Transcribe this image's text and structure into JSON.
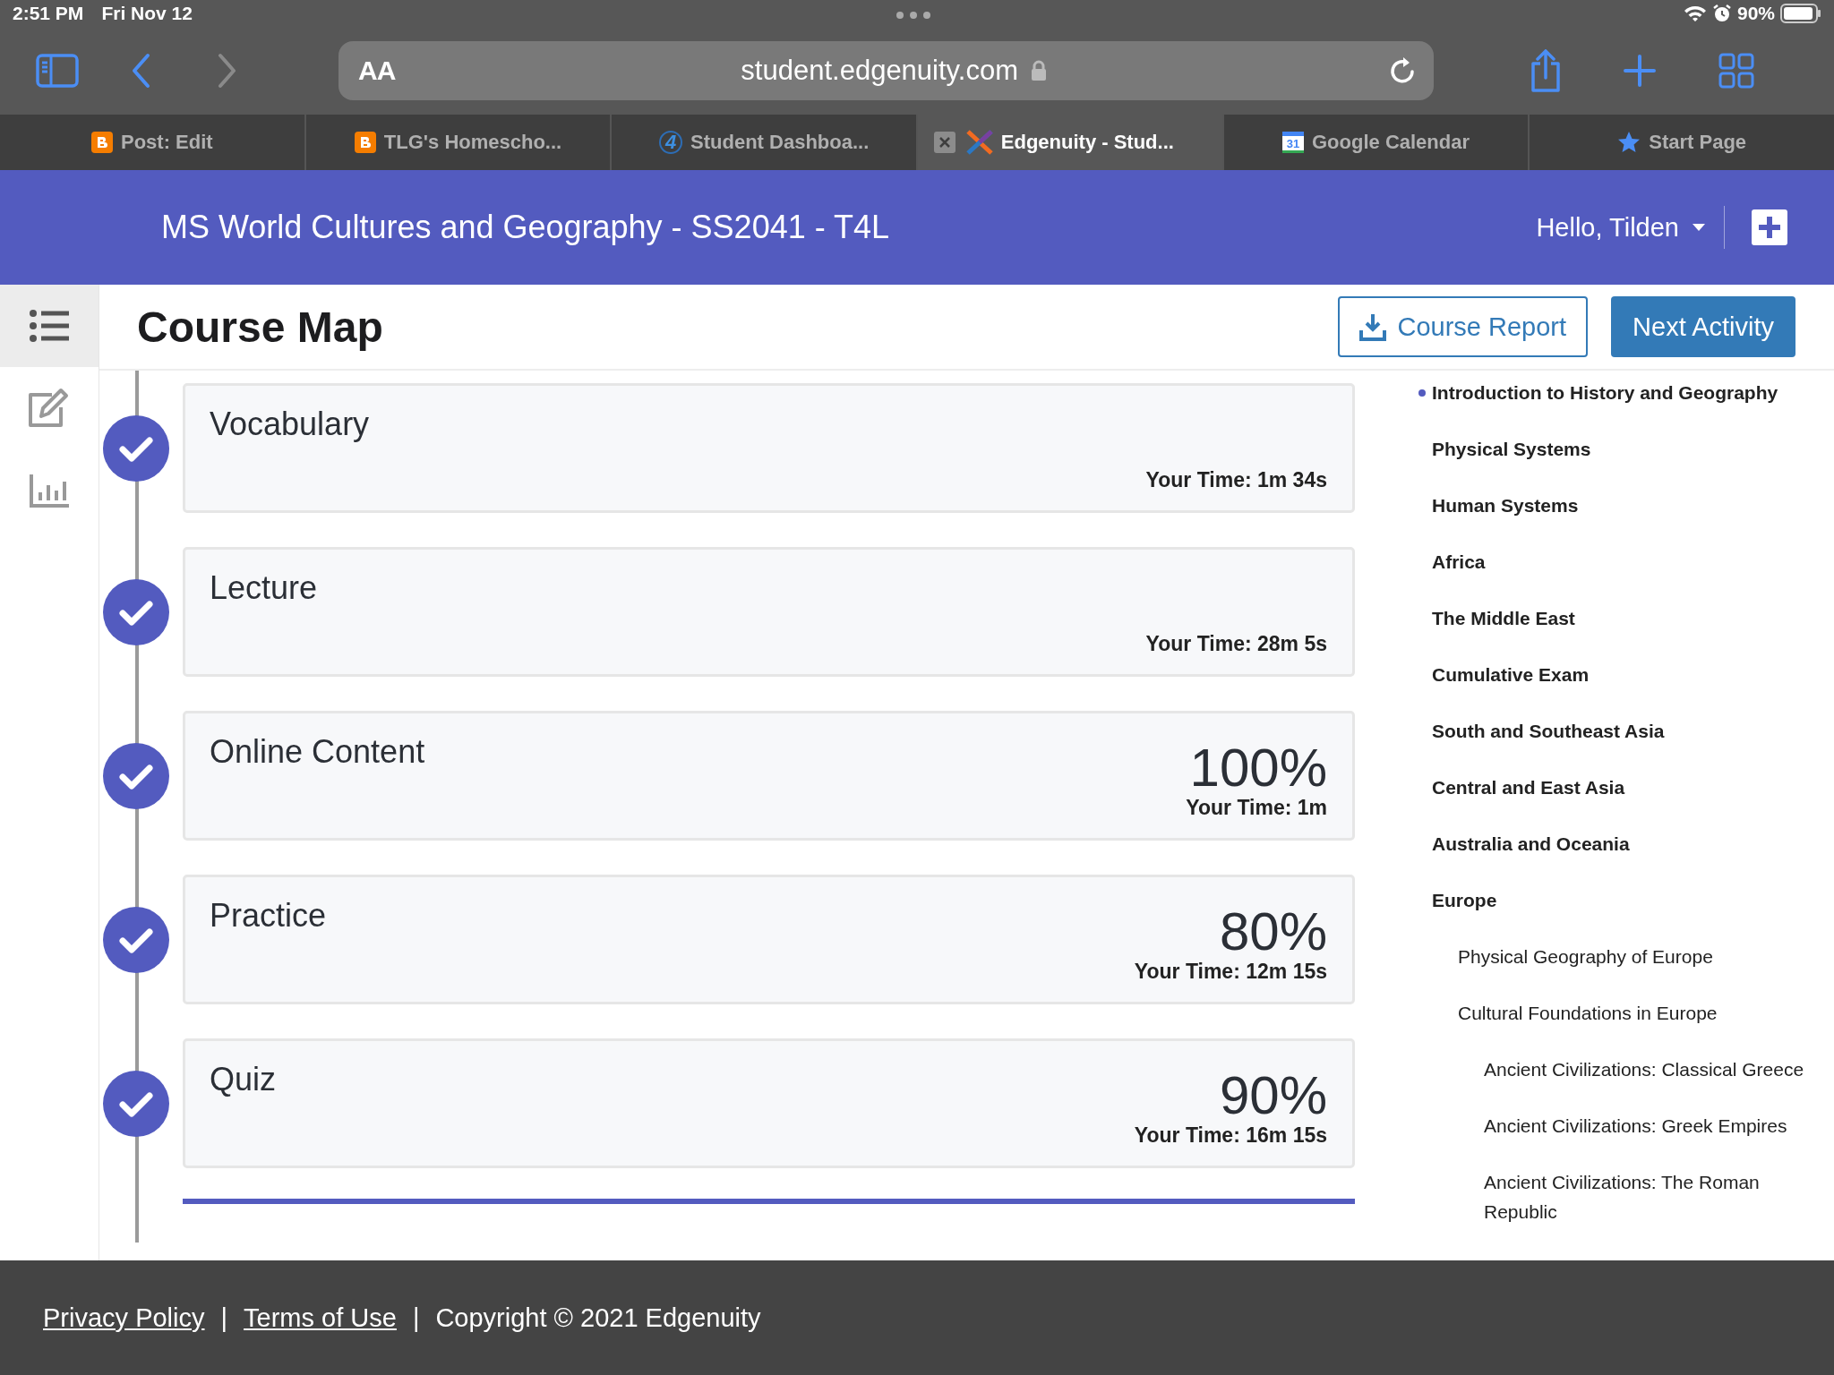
{
  "status_bar": {
    "time": "2:51 PM",
    "date": "Fri Nov 12",
    "battery": "90%"
  },
  "browser": {
    "text_size": "AA",
    "url": "student.edgenuity.com",
    "tabs": [
      {
        "label": "Post: Edit",
        "kind": "blogger",
        "selected": false
      },
      {
        "label": "TLG's Homescho...",
        "kind": "blogger",
        "selected": false
      },
      {
        "label": "Student Dashboa...",
        "kind": "dashboard",
        "icon_text": "4",
        "selected": false
      },
      {
        "label": "Edgenuity - Stud...",
        "kind": "edgenuity",
        "selected": true
      },
      {
        "label": "Google Calendar",
        "kind": "calendar",
        "icon_text": "31",
        "selected": false
      },
      {
        "label": "Start Page",
        "kind": "star",
        "selected": false
      }
    ]
  },
  "header": {
    "course_title": "MS World Cultures and Geography - SS2041 - T4L",
    "greeting": "Hello, Tilden"
  },
  "sidebar": [
    {
      "kind": "list",
      "selected": true
    },
    {
      "kind": "edit",
      "selected": false
    },
    {
      "kind": "chart",
      "selected": false
    }
  ],
  "page": {
    "title": "Course Map",
    "course_report": "Course Report",
    "next_activity": "Next Activity"
  },
  "activities": [
    {
      "title": "Vocabulary",
      "time": "Your Time: 1m 34s",
      "completed": true
    },
    {
      "title": "Lecture",
      "time": "Your Time: 28m 5s",
      "completed": true
    },
    {
      "title": "Online Content",
      "score": "100%",
      "time": "Your Time: 1m",
      "completed": true
    },
    {
      "title": "Practice",
      "score": "80%",
      "time": "Your Time: 12m 15s",
      "completed": true
    },
    {
      "title": "Quiz",
      "score": "90%",
      "time": "Your Time: 16m 15s",
      "completed": true
    }
  ],
  "outline": [
    {
      "label": "Introduction to History and Geography",
      "current": true
    },
    {
      "label": "Physical Systems",
      "current": false
    },
    {
      "label": "Human Systems",
      "current": false
    },
    {
      "label": "Africa",
      "current": false
    },
    {
      "label": "The Middle East",
      "current": false
    },
    {
      "label": "Cumulative Exam",
      "current": false
    },
    {
      "label": "South and Southeast Asia",
      "current": false
    },
    {
      "label": "Central and East Asia",
      "current": false
    },
    {
      "label": "Australia and Oceania",
      "current": false
    },
    {
      "label": "Europe",
      "current": false,
      "children": [
        {
          "label": "Physical Geography of Europe",
          "current": false
        },
        {
          "label": "Cultural Foundations in Europe",
          "current": false,
          "children": [
            {
              "label": "Ancient Civilizations: Classical Greece",
              "current": false
            },
            {
              "label": "Ancient Civilizations: Greek Empires",
              "current": false
            },
            {
              "label": "Ancient Civilizations: The Roman Republic",
              "current": false
            }
          ]
        }
      ]
    }
  ],
  "footer": [
    {
      "kind": "link",
      "text": "Privacy Policy"
    },
    {
      "kind": "separator",
      "text": "|"
    },
    {
      "kind": "link",
      "text": "Terms of Use"
    },
    {
      "kind": "separator",
      "text": "|"
    },
    {
      "kind": "text",
      "text": "Copyright © 2021 Edgenuity"
    }
  ]
}
